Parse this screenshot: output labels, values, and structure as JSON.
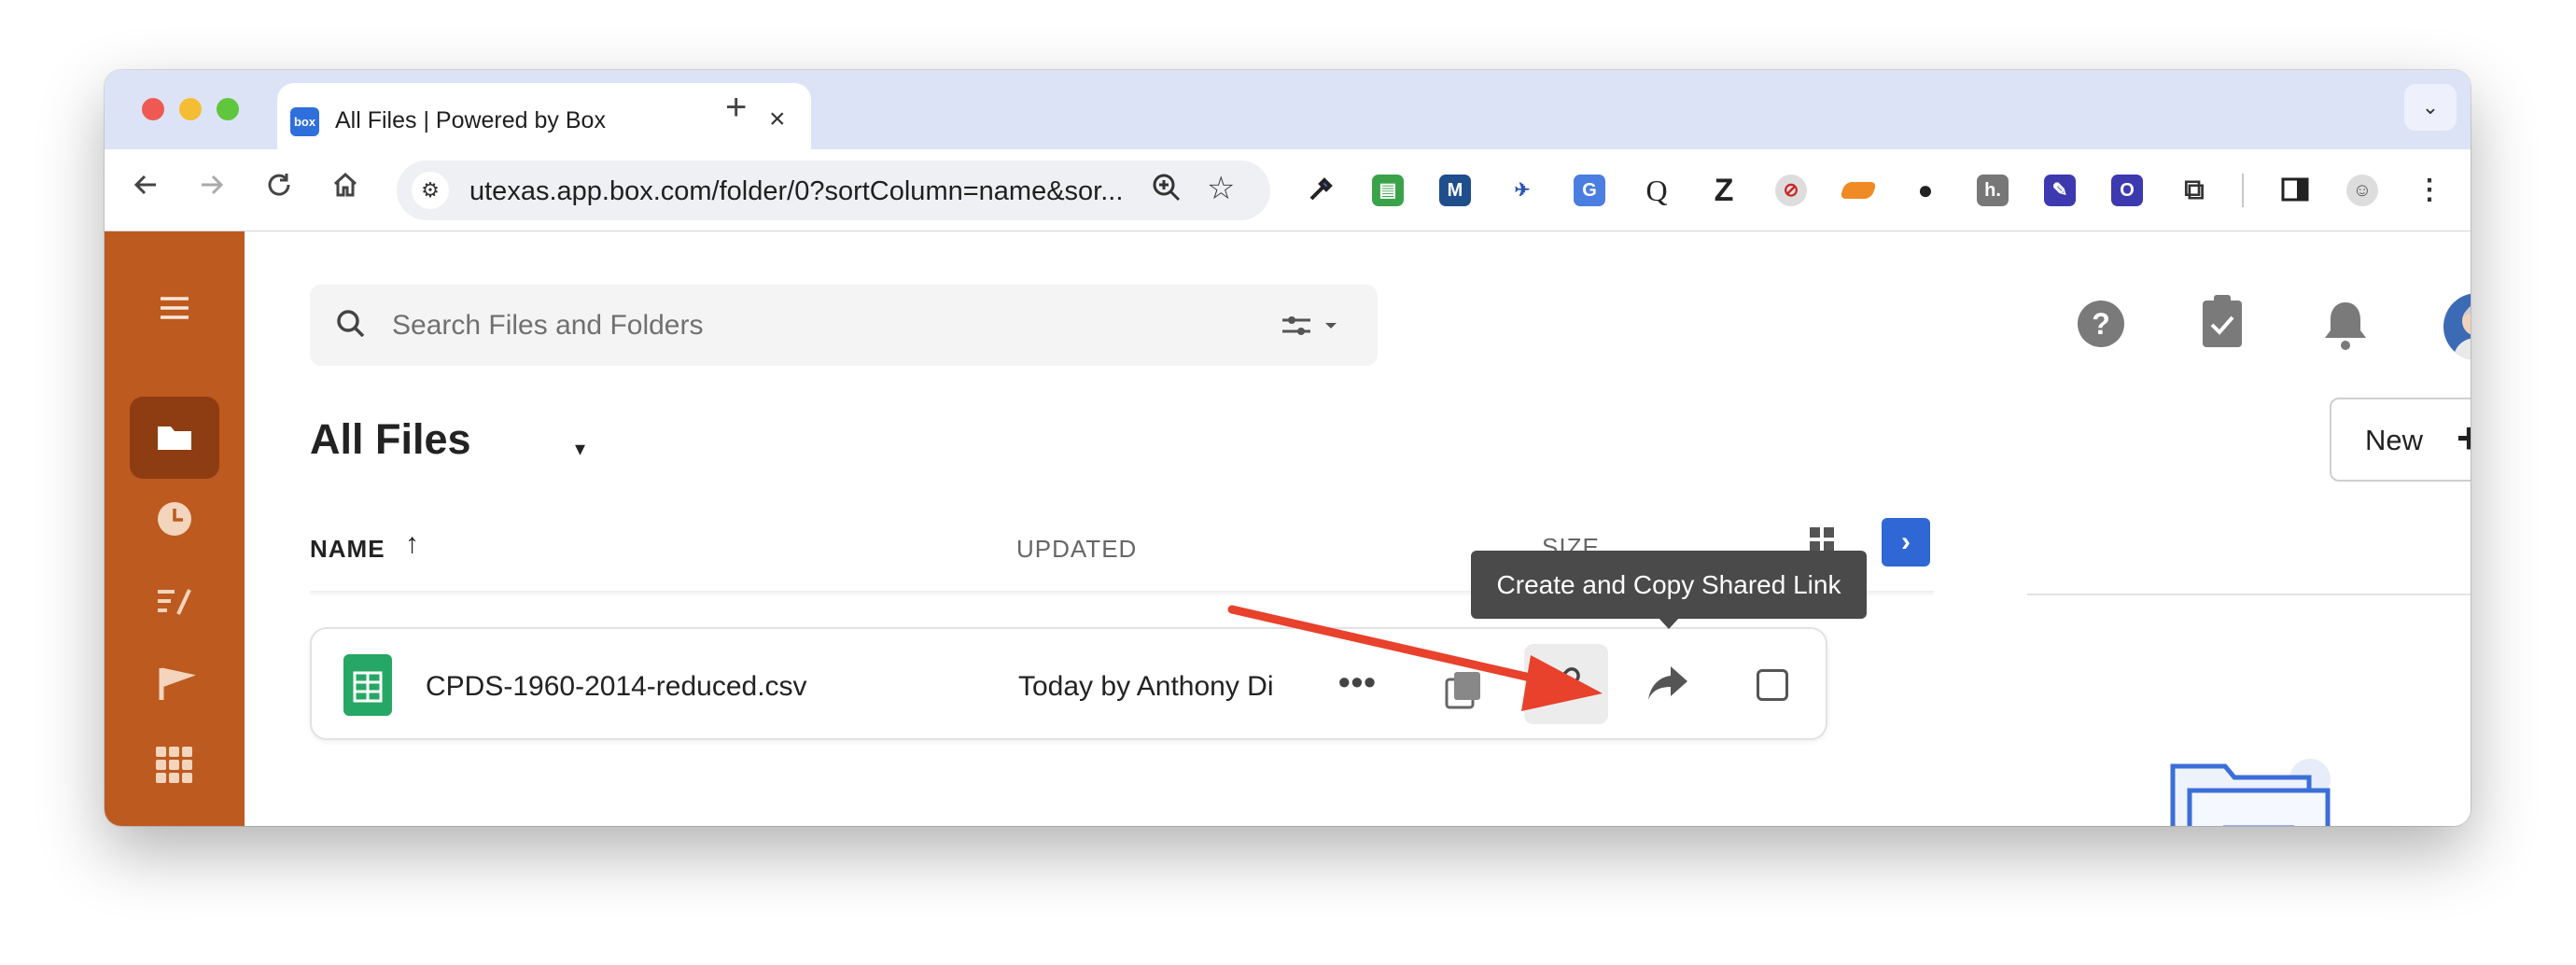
{
  "browser": {
    "tab_title": "All Files | Powered by Box",
    "favicon_text": "box",
    "url": "utexas.app.box.com/folder/0?sortColumn=name&sor...",
    "extensions": [
      "eyedropper-icon",
      "printer-icon",
      "M",
      "translate-icon",
      "google-translate-icon",
      "Q",
      "Z",
      "blocker-icon",
      "ruler-icon",
      "circles-icon",
      "h",
      "edit-icon",
      "O",
      "puzzle-icon"
    ],
    "extension_letters": {
      "m": "M",
      "q": "Q",
      "z": "Z",
      "h": "h.",
      "o": "O"
    }
  },
  "sidebar": {
    "items": [
      "menu-icon",
      "folder-icon",
      "clock-icon",
      "notes-icon",
      "flag-icon",
      "apps-icon"
    ]
  },
  "search": {
    "placeholder": "Search Files and Folders"
  },
  "header": {
    "title": "All Files",
    "new_label": "New",
    "new_icon": "+"
  },
  "columns": {
    "name": "NAME",
    "updated": "UPDATED",
    "size": "SIZE"
  },
  "files": [
    {
      "name": "CPDS-1960-2014-reduced.csv",
      "updated": "Today by Anthony Di"
    }
  ],
  "tooltip": "Create and Copy Shared Link",
  "colors": {
    "sidebar": "#bd5a1f",
    "sidebar_active": "#8e3c12",
    "accent_blue": "#2f67d5",
    "annotation_arrow": "#e8412c",
    "spreadsheet_green": "#27a765"
  }
}
